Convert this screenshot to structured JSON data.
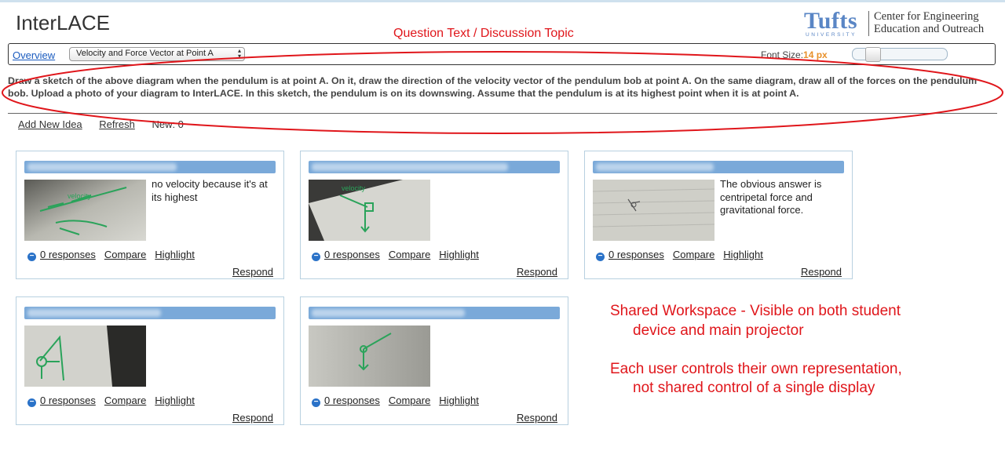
{
  "app": {
    "title": "InterLACE"
  },
  "logo": {
    "word": "Tufts",
    "sub": "UNIVERSITY",
    "line1": "Center for Engineering",
    "line2": "Education and Outreach"
  },
  "annotations": {
    "question_label": "Question Text / Discussion Topic",
    "workspace_line1": "Shared Workspace - Visible on both student",
    "workspace_line2": "device and main projector",
    "control_line1": "Each user controls their own representation,",
    "control_line2": "not shared control of a single display",
    "color": "#e0161b"
  },
  "toolbar": {
    "overview": "Overview",
    "selected_topic": "Velocity and Force Vector at Point A",
    "font_size_label": "Font Size:",
    "font_size_value": "14 px"
  },
  "question": {
    "text": "Draw a sketch of the above diagram when the pendulum is at point A. On it, draw the direction of the velocity vector of the pendulum bob at point A. On the same diagram, draw all of the forces on the pendulum bob. Upload a photo of your diagram to InterLACE. In this sketch, the pendulum is on its downswing. Assume that the pendulum is at its highest point when it is at point A."
  },
  "actions": {
    "add": "Add New Idea",
    "refresh": "Refresh",
    "new_count": "New: 0"
  },
  "cards": [
    {
      "text": "no velocity because it's at its highest",
      "responses": "0 responses",
      "compare": "Compare",
      "highlight": "Highlight",
      "respond": "Respond"
    },
    {
      "text": "",
      "responses": "0 responses",
      "compare": "Compare",
      "highlight": "Highlight",
      "respond": "Respond"
    },
    {
      "text": "The obvious answer is centripetal force and gravitational force.",
      "responses": "0 responses",
      "compare": "Compare",
      "highlight": "Highlight",
      "respond": "Respond"
    },
    {
      "text": "",
      "responses": "0 responses",
      "compare": "Compare",
      "highlight": "Highlight",
      "respond": "Respond"
    },
    {
      "text": "",
      "responses": "0 responses",
      "compare": "Compare",
      "highlight": "Highlight",
      "respond": "Respond"
    }
  ]
}
